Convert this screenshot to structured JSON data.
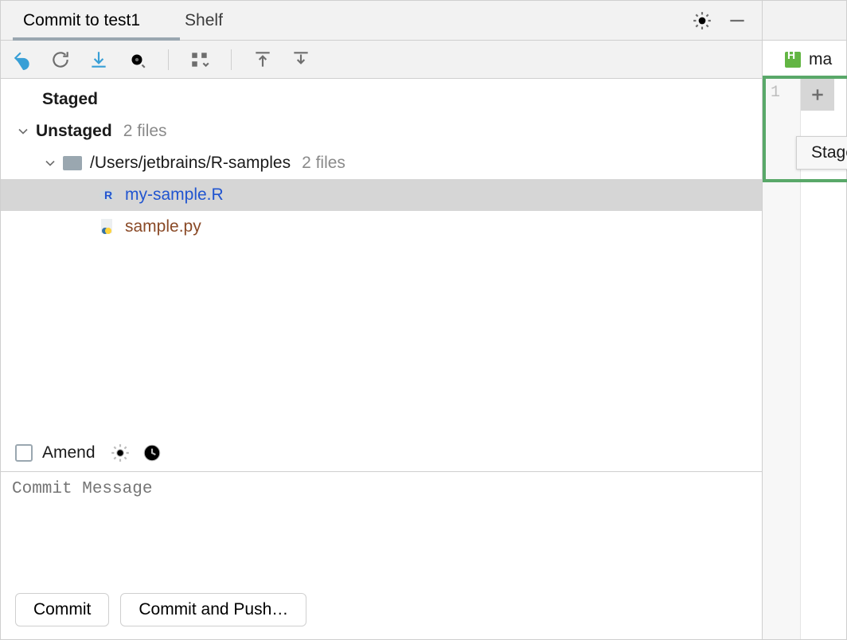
{
  "tabs": {
    "commit": "Commit to test1",
    "shelf": "Shelf"
  },
  "sections": {
    "staged": "Staged",
    "unstaged": "Unstaged",
    "unstaged_count": "2 files",
    "folder_path": "/Users/jetbrains/R-samples",
    "folder_count": "2 files",
    "files": [
      {
        "name": "my-sample.R",
        "type": "r"
      },
      {
        "name": "sample.py",
        "type": "py"
      }
    ]
  },
  "amend": {
    "label": "Amend"
  },
  "message": {
    "placeholder": "Commit Message"
  },
  "buttons": {
    "commit": "Commit",
    "commit_push": "Commit and Push…"
  },
  "right": {
    "crumb": "ma",
    "line1": "1",
    "stage_tooltip": "Stage"
  }
}
